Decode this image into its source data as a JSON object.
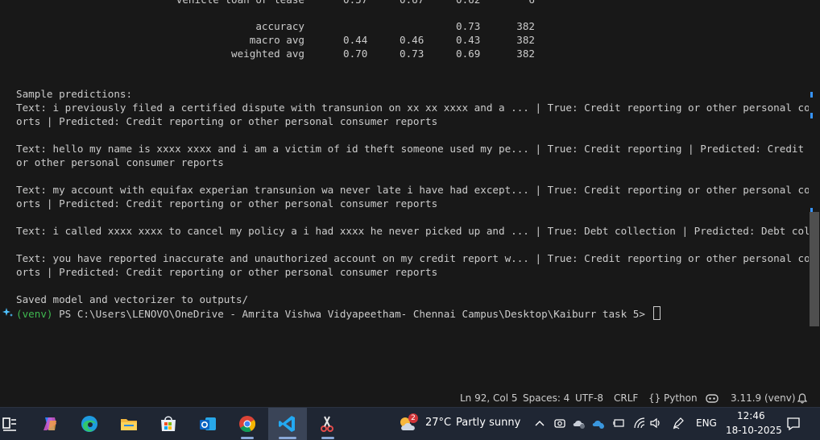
{
  "terminal": {
    "report_rows": [
      {
        "label": "vehicle loan or lease",
        "precision": "0.57",
        "recall": "0.67",
        "f1": "0.62",
        "support": "6"
      },
      {
        "label": "accuracy",
        "precision": "",
        "recall": "",
        "f1": "0.73",
        "support": "382"
      },
      {
        "label": "macro avg",
        "precision": "0.44",
        "recall": "0.46",
        "f1": "0.43",
        "support": "382"
      },
      {
        "label": "weighted avg",
        "precision": "0.70",
        "recall": "0.73",
        "f1": "0.69",
        "support": "382"
      }
    ],
    "sample_header": "Sample predictions:",
    "lines": [
      "Text: i previously filed a certified dispute with transunion on xx xx xxxx and a ... | True: Credit reporting or other personal consumer rep",
      "orts | Predicted: Credit reporting or other personal consumer reports",
      "",
      "Text: hello my name is xxxx xxxx and i am a victim of id theft someone used my pe... | True: Credit reporting | Predicted: Credit reporting",
      "or other personal consumer reports",
      "",
      "Text: my account with equifax experian transunion wa never late i have had except... | True: Credit reporting or other personal consumer rep",
      "orts | Predicted: Credit reporting or other personal consumer reports",
      "",
      "Text: i called xxxx xxxx to cancel my policy a i had xxxx he never picked up and ... | True: Debt collection | Predicted: Debt collection",
      "",
      "Text: you have reported inaccurate and unauthorized account on my credit report w... | True: Credit reporting or other personal consumer rep",
      "orts | Predicted: Credit reporting or other personal consumer reports",
      "",
      "Saved model and vectorizer to outputs/"
    ],
    "prompt_venv": "(venv)",
    "prompt_path": " PS C:\\Users\\LENOVO\\OneDrive - Amrita Vishwa Vidyapeetham- Chennai Campus\\Desktop\\Kaiburr task 5> "
  },
  "statusbar": {
    "position": "Ln 92, Col 5",
    "spaces": "Spaces: 4",
    "encoding": "UTF-8",
    "eol": "CRLF",
    "language_icon": "braces-icon",
    "language": "Python",
    "copilot_icon": "copilot-icon",
    "interpreter": "3.11.9 (venv)",
    "bell_icon": "bell-icon"
  },
  "taskbar": {
    "apps": [
      "widgets-icon",
      "copilot-app-icon",
      "edge-icon",
      "file-explorer-icon",
      "store-icon",
      "outlook-icon",
      "chrome-icon",
      "vscode-icon",
      "snipping-tool-icon"
    ],
    "weather_badge": "2",
    "weather_temp": "27°C",
    "weather_desc": "Partly sunny",
    "language": "ENG",
    "time": "12:46",
    "date": "18-10-2025"
  },
  "colors": {
    "terminal_bg": "#181818",
    "terminal_fg": "#cccccc",
    "venv_green": "#3fb950",
    "taskbar_bg": "#1f2633",
    "accent_blue": "#3794ff"
  }
}
